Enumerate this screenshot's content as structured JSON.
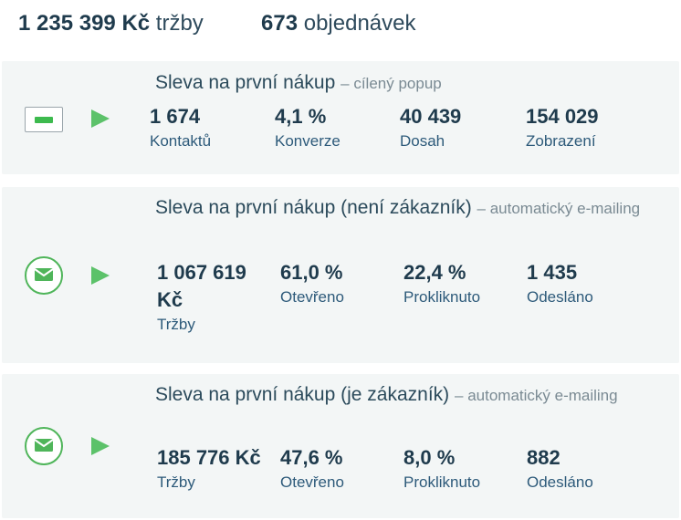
{
  "summary": {
    "revenue_value": "1 235 399 Kč",
    "revenue_label": "tržby",
    "orders_value": "673",
    "orders_label": "objednávek"
  },
  "campaigns": [
    {
      "name": "Sleva na první nákup",
      "type": "– cílený popup",
      "icon": "popup-icon",
      "metrics": [
        {
          "value": "1 674",
          "label": "Kontaktů"
        },
        {
          "value": "4,1 %",
          "label": "Konverze"
        },
        {
          "value": "40 439",
          "label": "Dosah"
        },
        {
          "value": "154 029",
          "label": "Zobrazení"
        }
      ]
    },
    {
      "name": "Sleva na první nákup (není zákazník)",
      "type": "– automatický e-mailing",
      "icon": "email-icon",
      "metrics": [
        {
          "value": "1 067 619 Kč",
          "label": "Tržby"
        },
        {
          "value": "61,0 %",
          "label": "Otevřeno"
        },
        {
          "value": "22,4 %",
          "label": "Prokliknuto"
        },
        {
          "value": "1 435",
          "label": "Odesláno"
        }
      ]
    },
    {
      "name": "Sleva na první nákup (je zákazník)",
      "type": "– automatický e-mailing",
      "icon": "email-icon",
      "metrics": [
        {
          "value": "185 776 Kč",
          "label": "Tržby"
        },
        {
          "value": "47,6 %",
          "label": "Otevřeno"
        },
        {
          "value": "8,0 %",
          "label": "Prokliknuto"
        },
        {
          "value": "882",
          "label": "Odesláno"
        }
      ]
    }
  ],
  "colors": {
    "accent_green": "#5cc26a",
    "text_dark": "#1f3b4d",
    "label_blue": "#2d5a7a",
    "card_bg": "#f3f6f6"
  }
}
